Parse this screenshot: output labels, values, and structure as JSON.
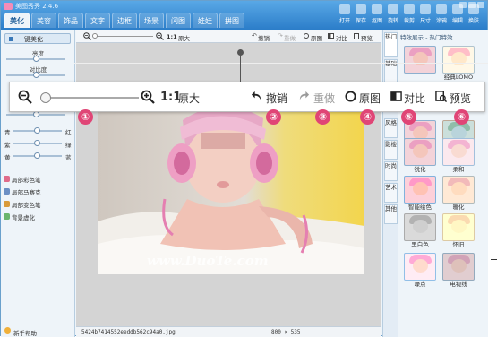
{
  "app": {
    "title": "美图秀秀 2.4.6"
  },
  "main_tabs": [
    "美化",
    "美容",
    "饰品",
    "文字",
    "边框",
    "场景",
    "闪图",
    "娃娃",
    "拼图"
  ],
  "tools": [
    "打开",
    "保存",
    "抠图",
    "旋转",
    "裁剪",
    "尺寸",
    "涂鸦",
    "编辑",
    "换肤"
  ],
  "left_panel": {
    "auto_btn": "一键美化",
    "brightness": "亮度",
    "contrast": "对比度",
    "color_rows": [
      {
        "left": "青",
        "right": "红",
        "value": 0.5
      },
      {
        "left": "紫",
        "right": "绿",
        "value": 0.5
      },
      {
        "left": "黄",
        "right": "蓝",
        "value": 0.5
      }
    ],
    "pens": [
      "局部彩色笔",
      "局部马赛克",
      "局部变色笔",
      "背景虚化"
    ],
    "help": "新手帮助"
  },
  "canvas": {
    "zoom_ratio": "1:1",
    "original": "原大",
    "undo": "撤销",
    "redo": "重做",
    "orig_img": "原图",
    "compare": "对比",
    "preview": "预览",
    "filename": "5424b7414552eeddb562c94a0.jpg",
    "size": "800 × 535",
    "watermark": "www.DuoTe.com"
  },
  "overlay": {
    "ratio": "1:1",
    "original": "原大",
    "undo": "撤销",
    "redo": "重做",
    "orig_img": "原图",
    "compare": "对比",
    "preview": "预览",
    "badges": [
      "①",
      "②",
      "③",
      "④",
      "⑤",
      "⑥"
    ]
  },
  "side_tabs": [
    "热门",
    "基础",
    "风格",
    "影楼",
    "时尚",
    "艺术",
    "其他"
  ],
  "right_panel": {
    "title": "特效展示 - 热门特效",
    "effects": [
      "",
      "经典LOMO",
      "",
      "",
      "",
      "冷色",
      "锐化",
      "柔和",
      "智能绘色",
      "暖化",
      "黑白色",
      "怀旧",
      "噪点",
      "电视线"
    ]
  }
}
